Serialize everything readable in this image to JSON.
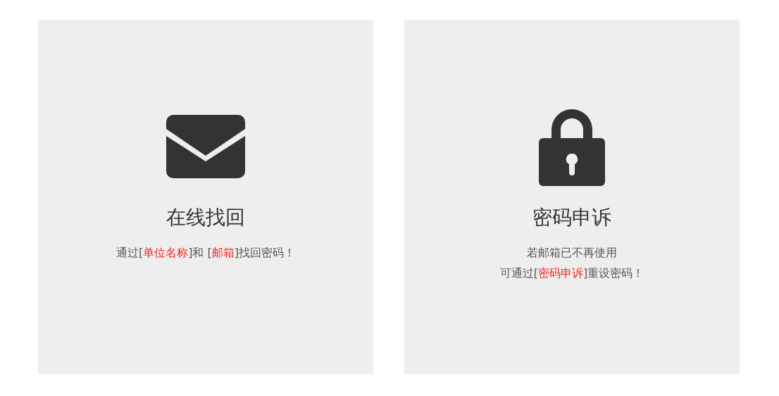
{
  "cards": [
    {
      "kind": "envelope",
      "title": "在线找回",
      "lines": [
        [
          {
            "text": "通过[",
            "highlight": false
          },
          {
            "text": "单位名称",
            "highlight": true
          },
          {
            "text": "]和 [",
            "highlight": false
          },
          {
            "text": "邮箱",
            "highlight": true
          },
          {
            "text": "]找回密码！",
            "highlight": false
          }
        ]
      ]
    },
    {
      "kind": "lock",
      "title": "密码申诉",
      "lines": [
        [
          {
            "text": "若邮箱已不再使用",
            "highlight": false
          }
        ],
        [
          {
            "text": "可通过[",
            "highlight": false
          },
          {
            "text": "密码申诉",
            "highlight": true
          },
          {
            "text": "]重设密码！",
            "highlight": false
          }
        ]
      ]
    }
  ]
}
